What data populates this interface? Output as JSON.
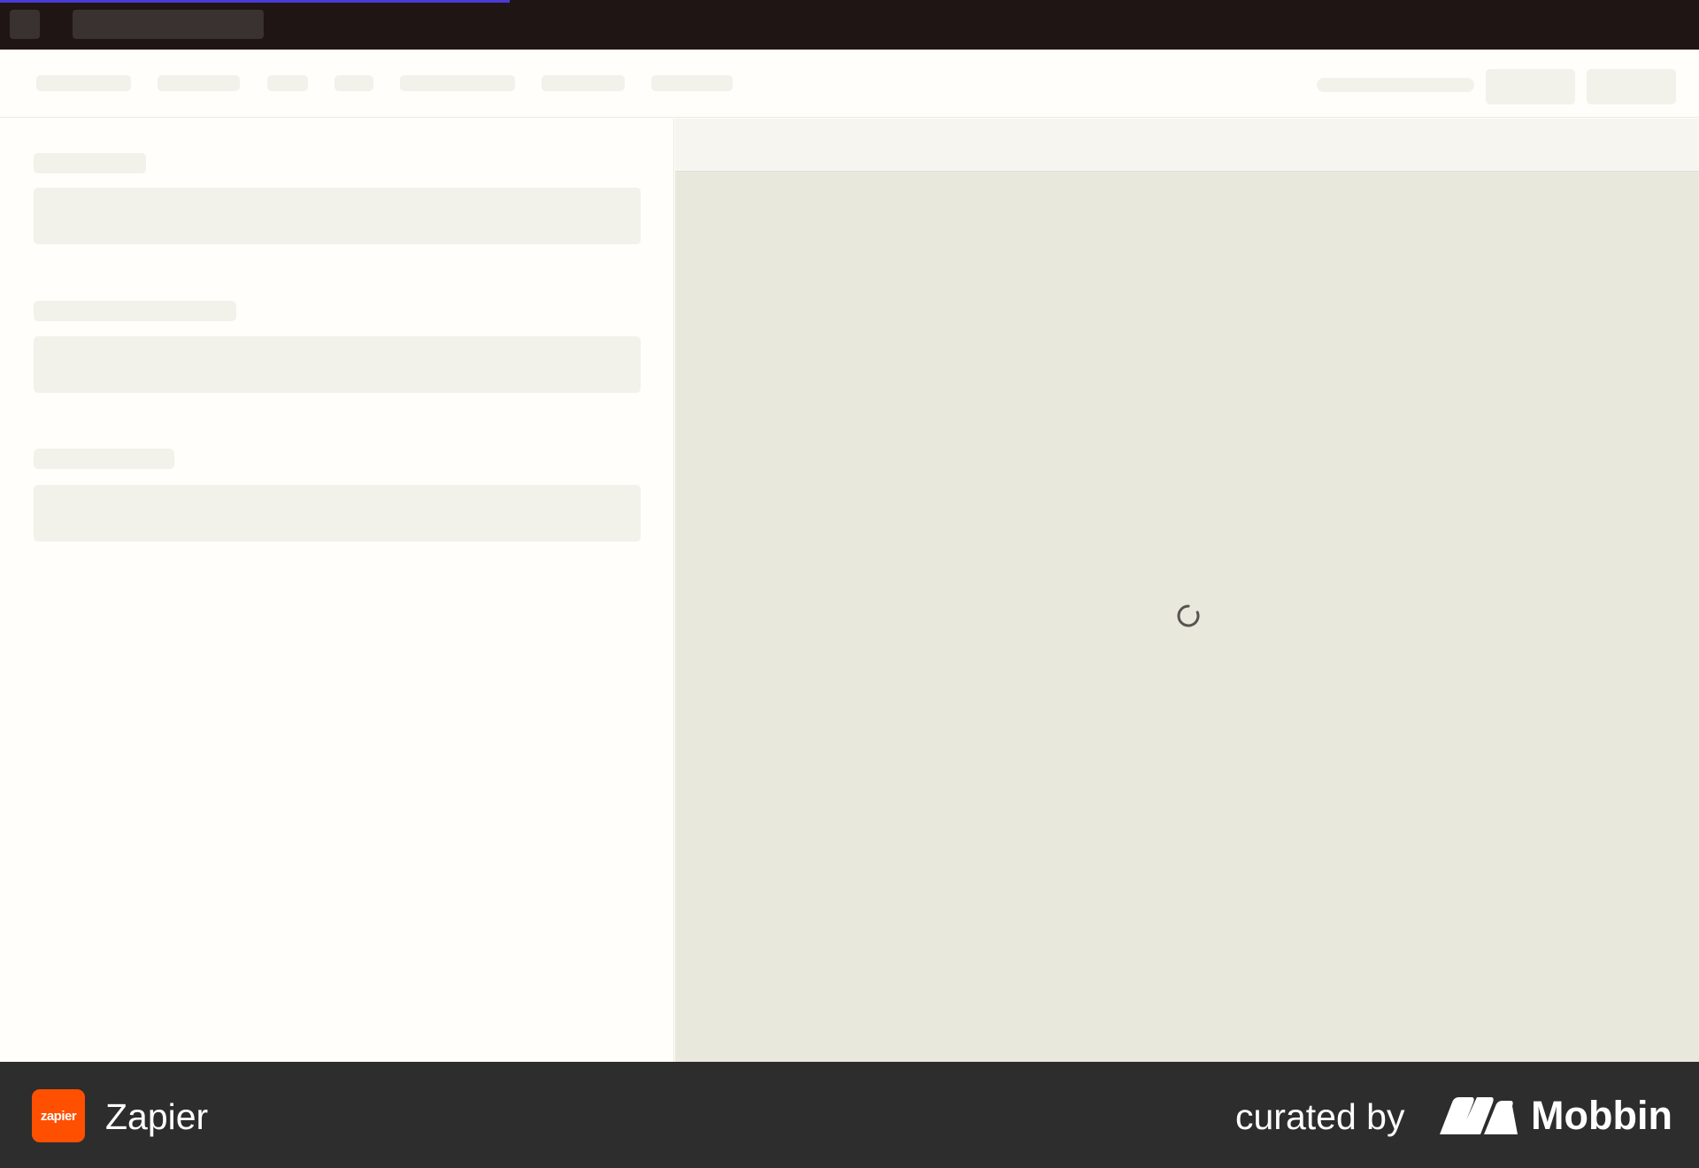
{
  "app": {
    "name": "Zapier",
    "logo_text": "zapier",
    "accent_color": "#ff4f00"
  },
  "loading": {
    "state": "loading",
    "progress_fraction": 0.3
  },
  "icons": {
    "spinner": "loading-spinner-icon",
    "brand_mark": "mobbin-logo-icon"
  },
  "footer": {
    "curated_by": "curated by",
    "brand": "Mobbin"
  }
}
